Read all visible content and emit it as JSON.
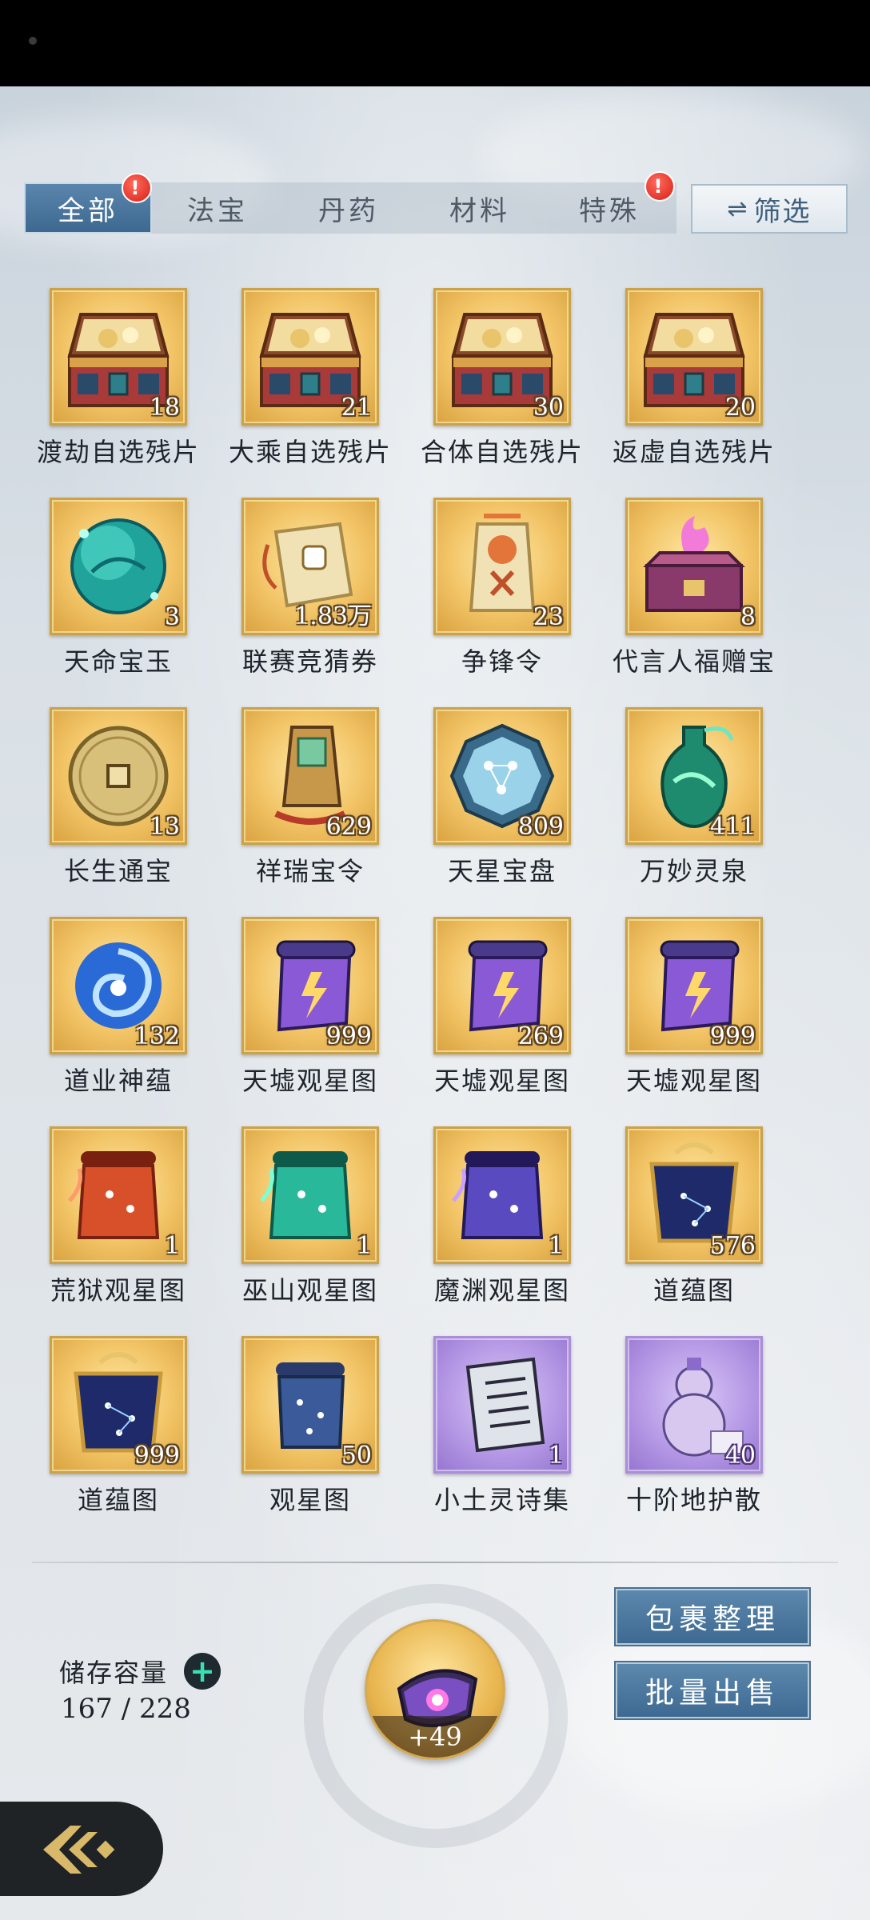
{
  "tabs": [
    {
      "label": "全部",
      "active": true,
      "badge": "!"
    },
    {
      "label": "法宝",
      "active": false
    },
    {
      "label": "丹药",
      "active": false
    },
    {
      "label": "材料",
      "active": false
    },
    {
      "label": "特殊",
      "active": false,
      "badge": "!"
    }
  ],
  "filter_button": {
    "label": "筛选",
    "icon": "swap-arrows-icon"
  },
  "items": [
    {
      "name": "渡劫自选残片",
      "count": "18",
      "icon": "treasure-chest-icon",
      "rarity": "gold"
    },
    {
      "name": "大乘自选残片",
      "count": "21",
      "icon": "treasure-chest-icon",
      "rarity": "gold"
    },
    {
      "name": "合体自选残片",
      "count": "30",
      "icon": "treasure-chest-icon",
      "rarity": "gold"
    },
    {
      "name": "返虚自选残片",
      "count": "20",
      "icon": "treasure-chest-icon",
      "rarity": "gold"
    },
    {
      "name": "天命宝玉",
      "count": "3",
      "icon": "jade-orb-icon",
      "rarity": "gold"
    },
    {
      "name": "联赛竞猜券",
      "count": "1.83万",
      "icon": "scroll-ticket-icon",
      "rarity": "gold"
    },
    {
      "name": "争锋令",
      "count": "23",
      "icon": "token-tag-icon",
      "rarity": "gold"
    },
    {
      "name": "代言人福赠宝",
      "count": "8",
      "icon": "spirit-box-icon",
      "rarity": "gold"
    },
    {
      "name": "长生通宝",
      "count": "13",
      "icon": "coin-icon",
      "rarity": "gold"
    },
    {
      "name": "祥瑞宝令",
      "count": "629",
      "icon": "auspicious-token-icon",
      "rarity": "gold"
    },
    {
      "name": "天星宝盘",
      "count": "809",
      "icon": "star-disc-icon",
      "rarity": "gold"
    },
    {
      "name": "万妙灵泉",
      "count": "411",
      "icon": "spirit-vase-icon",
      "rarity": "gold"
    },
    {
      "name": "道业神蕴",
      "count": "132",
      "icon": "blue-vortex-icon",
      "rarity": "gold"
    },
    {
      "name": "天墟观星图",
      "count": "999",
      "icon": "purple-scroll-icon",
      "rarity": "gold"
    },
    {
      "name": "天墟观星图",
      "count": "269",
      "icon": "purple-scroll-icon",
      "rarity": "gold"
    },
    {
      "name": "天墟观星图",
      "count": "999",
      "icon": "purple-scroll-icon",
      "rarity": "gold"
    },
    {
      "name": "荒狱观星图",
      "count": "1",
      "icon": "red-star-map-icon",
      "rarity": "gold"
    },
    {
      "name": "巫山观星图",
      "count": "1",
      "icon": "green-star-map-icon",
      "rarity": "gold"
    },
    {
      "name": "魔渊观星图",
      "count": "1",
      "icon": "violet-star-map-icon",
      "rarity": "gold"
    },
    {
      "name": "道蕴图",
      "count": "576",
      "icon": "ornate-star-map-icon",
      "rarity": "gold"
    },
    {
      "name": "道蕴图",
      "count": "999",
      "icon": "ornate-star-map-icon",
      "rarity": "gold"
    },
    {
      "name": "观星图",
      "count": "50",
      "icon": "blue-star-map-icon",
      "rarity": "gold"
    },
    {
      "name": "小土灵诗集",
      "count": "1",
      "icon": "poem-book-icon",
      "rarity": "purple"
    },
    {
      "name": "十阶地护散",
      "count": "40",
      "icon": "gourd-icon",
      "rarity": "purple"
    }
  ],
  "storage": {
    "label": "储存容量",
    "value": "167 / 228",
    "add_icon": "plus-icon"
  },
  "bag": {
    "badge": "+49",
    "icon": "storage-ring-icon"
  },
  "actions": {
    "organize": "包裹整理",
    "bulk_sell": "批量出售"
  },
  "back_icon": "back-arrow-icon",
  "colors": {
    "accent": "#4a7aa3",
    "gold_frame": "#c9a24a",
    "purple_frame": "#a98fd6",
    "badge_red": "#e02a1f"
  }
}
